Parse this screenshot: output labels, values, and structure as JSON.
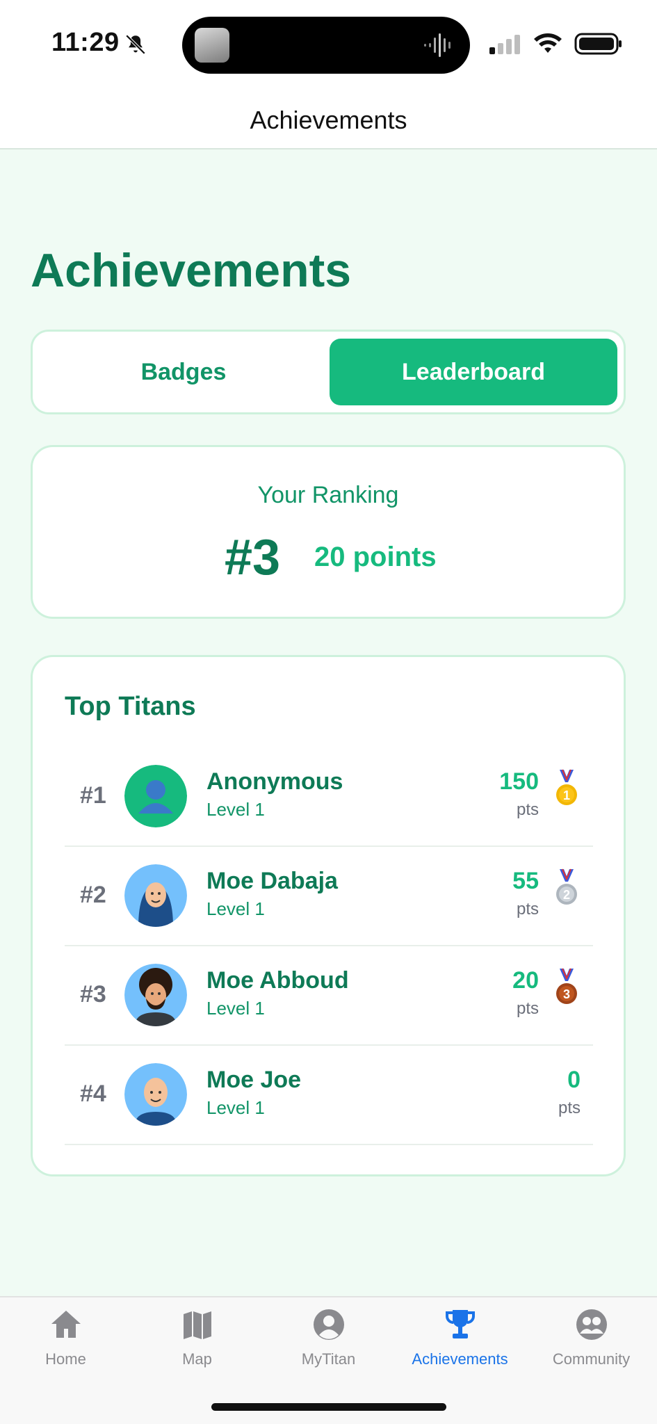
{
  "status_bar": {
    "time": "11:29"
  },
  "header": {
    "title": "Achievements"
  },
  "page": {
    "title": "Achievements"
  },
  "tabs_segment": {
    "badges": "Badges",
    "leaderboard": "Leaderboard",
    "selected": "Leaderboard"
  },
  "ranking": {
    "label": "Your Ranking",
    "rank": "#3",
    "points": "20 points"
  },
  "leaderboard": {
    "title": "Top Titans",
    "rows": [
      {
        "rank": "#1",
        "name": "Anonymous",
        "level": "Level 1",
        "pts": "150",
        "pts_label": "pts",
        "medal": "gold-medal-icon",
        "avatar": "default-person-avatar"
      },
      {
        "rank": "#2",
        "name": "Moe Dabaja",
        "level": "Level 1",
        "pts": "55",
        "pts_label": "pts",
        "medal": "silver-medal-icon",
        "avatar": "hijab-woman-avatar"
      },
      {
        "rank": "#3",
        "name": "Moe Abboud",
        "level": "Level 1",
        "pts": "20",
        "pts_label": "pts",
        "medal": "bronze-medal-icon",
        "avatar": "curly-hair-man-avatar"
      },
      {
        "rank": "#4",
        "name": "Moe Joe",
        "level": "Level 1",
        "pts": "0",
        "pts_label": "pts",
        "medal": "",
        "avatar": "bald-man-avatar"
      }
    ]
  },
  "tabbar": {
    "items": [
      {
        "label": "Home",
        "icon": "home-icon"
      },
      {
        "label": "Map",
        "icon": "map-icon"
      },
      {
        "label": "MyTitan",
        "icon": "profile-icon"
      },
      {
        "label": "Achievements",
        "icon": "trophy-icon",
        "active": true
      },
      {
        "label": "Community",
        "icon": "community-icon"
      }
    ]
  },
  "colors": {
    "primary": "#0e7a56",
    "accent": "#16ba7e",
    "background": "#f0fbf4",
    "tab_active": "#1a73e8"
  }
}
